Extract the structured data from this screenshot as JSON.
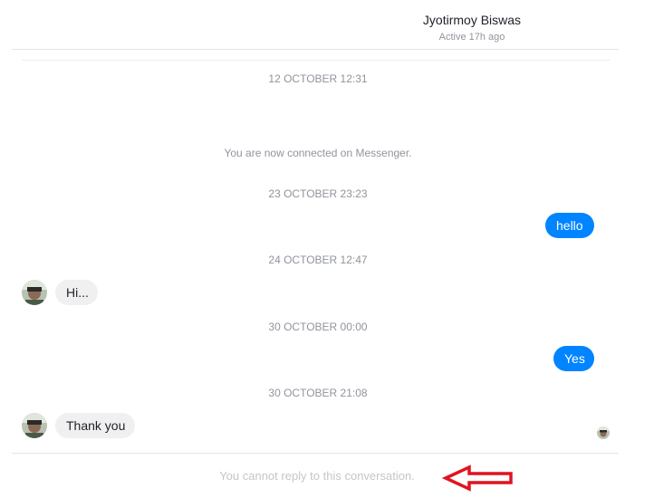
{
  "header": {
    "name": "Jyotirmoy Biswas",
    "status": "Active 17h ago"
  },
  "conversation": {
    "timestamps": [
      "12 OCTOBER 12:31",
      "23 OCTOBER 23:23",
      "24 OCTOBER 12:47",
      "30 OCTOBER 00:00",
      "30 OCTOBER 21:08"
    ],
    "system_message": "You are now connected on Messenger.",
    "messages": [
      {
        "direction": "outgoing",
        "text": "hello"
      },
      {
        "direction": "incoming",
        "text": "Hi..."
      },
      {
        "direction": "outgoing",
        "text": "Yes"
      },
      {
        "direction": "incoming",
        "text": "Thank you"
      }
    ]
  },
  "footer": {
    "notice": "You cannot reply to this conversation."
  },
  "colors": {
    "outgoing_bubble": "#0084ff",
    "incoming_bubble": "#f1f0f0",
    "annotation_arrow": "#e0141e"
  },
  "icons": {
    "avatar": "user-avatar-photo",
    "seen": "seen-avatar-icon",
    "annotation": "left-arrow-annotation"
  }
}
